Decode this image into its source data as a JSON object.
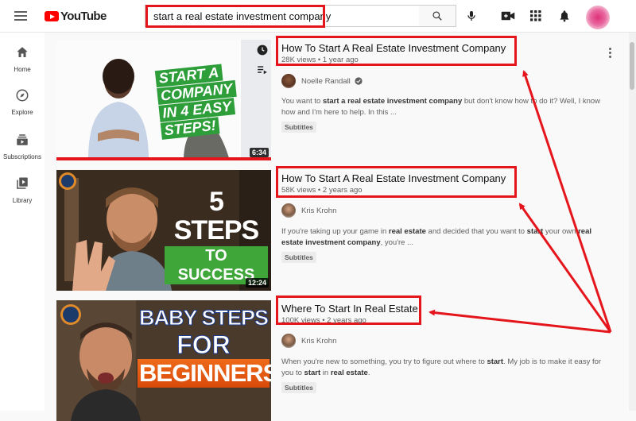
{
  "header": {
    "logo_text": "YouTube",
    "search_value": "start a real estate investment company",
    "search_placeholder": "Search"
  },
  "sidebar": {
    "items": [
      {
        "label": "Home",
        "icon": "home-icon"
      },
      {
        "label": "Explore",
        "icon": "compass-icon"
      },
      {
        "label": "Subscriptions",
        "icon": "subscriptions-icon"
      },
      {
        "label": "Library",
        "icon": "library-icon"
      }
    ]
  },
  "results": [
    {
      "title": "How To Start A Real Estate Investment Company",
      "meta": "28K views • 1 year ago",
      "channel": "Noelle Randall",
      "verified": true,
      "description_parts": [
        "You want to ",
        "start a real estate investment company",
        " but don't know how to do it? Well, I know how and I'm here to help. In this ..."
      ],
      "badge": "Subtitles",
      "duration": "6:34",
      "thumb_text": [
        "START A",
        "COMPANY",
        "IN 4 EASY",
        "STEPS!"
      ]
    },
    {
      "title": "How To Start A Real Estate Investment Company",
      "meta": "58K views • 2 years ago",
      "channel": "Kris Krohn",
      "verified": false,
      "description_parts": [
        "If you're taking up your game in ",
        "real estate",
        " and decided that you want to ",
        "start",
        " your own ",
        "real estate investment company",
        ", you're ..."
      ],
      "badge": "Subtitles",
      "duration": "12:24",
      "thumb_text": [
        "5 STEPS",
        "TO SUCCESS"
      ]
    },
    {
      "title": "Where To Start In Real Estate",
      "meta": "100K views • 2 years ago",
      "channel": "Kris Krohn",
      "verified": false,
      "description_parts": [
        "When you're new to something, you try to figure out where to ",
        "start",
        ". My job is to make it easy for you to ",
        "start",
        " in ",
        "real estate",
        "."
      ],
      "badge": "Subtitles",
      "duration": "",
      "thumb_text": [
        "BABY STEPS",
        "FOR",
        "BEGINNERS"
      ]
    }
  ],
  "colors": {
    "highlight": "#e4151b",
    "brand_red": "#ff0000",
    "thumb_green": "#2e9e3a"
  }
}
